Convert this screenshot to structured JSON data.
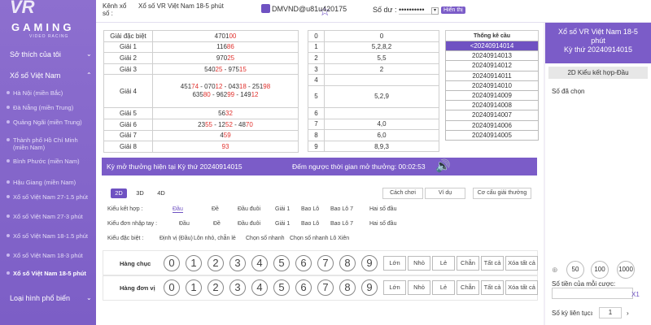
{
  "logo": {
    "main": "GAMING",
    "sub": "VIDEO RACING",
    "mark": "VR"
  },
  "sidebar": {
    "sections": [
      {
        "label": "Sở thích của tôi"
      },
      {
        "label": "Xổ số Việt Nam"
      },
      {
        "label": "Loại hình phổ biến"
      }
    ],
    "items": [
      {
        "label": "Hà Nội (miền Bắc)"
      },
      {
        "label": "Đà Nẵng (miền Trung)"
      },
      {
        "label": "Quảng Ngãi (miền Trung)"
      },
      {
        "label": "Thành phố Hồ Chí Minh (miền Nam)"
      },
      {
        "label": "Bình Phước (miền Nam)"
      },
      {
        "label": "Hậu Giang (miền Nam)"
      },
      {
        "label": "Xổ số Việt Nam 27-1.5 phút"
      },
      {
        "label": "Xổ số Việt Nam 27-3 phút"
      },
      {
        "label": "Xổ số Việt Nam 18-1.5 phút"
      },
      {
        "label": "Xổ số Việt Nam 18-3 phút"
      },
      {
        "label": "Xổ số Việt Nam 18-5 phút"
      }
    ]
  },
  "topbar": {
    "channel_label": "Kênh xổ số :",
    "channel_value": "Xổ số VR Việt Nam 18-5 phút",
    "username": "DMVND@u81u420175",
    "balance_label": "Số dư :",
    "balance_value": "••••••••••",
    "show_label": "Hiển thị"
  },
  "results": [
    {
      "prize": "Giải đặc biệt",
      "parts": [
        [
          "4701",
          "00"
        ]
      ]
    },
    {
      "prize": "Giải 1",
      "parts": [
        [
          "116",
          "86"
        ]
      ]
    },
    {
      "prize": "Giải 2",
      "parts": [
        [
          "970",
          "25"
        ]
      ]
    },
    {
      "prize": "Giải 3",
      "parts": [
        [
          "540",
          "25"
        ],
        [
          " - ",
          ""
        ],
        [
          "975",
          "15"
        ]
      ]
    },
    {
      "prize": "Giải 4",
      "parts": [
        [
          "451",
          "74"
        ],
        [
          " - ",
          ""
        ],
        [
          "070",
          "12"
        ],
        [
          " - ",
          ""
        ],
        [
          "043",
          "18"
        ],
        [
          " - ",
          ""
        ],
        [
          "251",
          "98"
        ],
        [
          "\n",
          ""
        ],
        [
          "635",
          "80"
        ],
        [
          " - ",
          ""
        ],
        [
          "962",
          "99"
        ],
        [
          " - ",
          ""
        ],
        [
          "149",
          "12"
        ]
      ]
    },
    {
      "prize": "Giải 5",
      "parts": [
        [
          "56",
          "32"
        ]
      ]
    },
    {
      "prize": "Giải 6",
      "parts": [
        [
          "23",
          "55"
        ],
        [
          " - ",
          ""
        ],
        [
          "12",
          "52"
        ],
        [
          " - ",
          ""
        ],
        [
          "48",
          "70"
        ]
      ]
    },
    {
      "prize": "Giải 7",
      "parts": [
        [
          "4",
          "59"
        ]
      ]
    },
    {
      "prize": "Giải 8",
      "parts": [
        [
          "",
          "93"
        ]
      ]
    }
  ],
  "head_tail": [
    {
      "head": "0",
      "tail": "0"
    },
    {
      "head": "1",
      "tail": "5,2,8,2"
    },
    {
      "head": "2",
      "tail": "5,5"
    },
    {
      "head": "3",
      "tail": "2"
    },
    {
      "head": "4",
      "tail": ""
    },
    {
      "head": "5",
      "tail": "5,2,9"
    },
    {
      "head": "6",
      "tail": ""
    },
    {
      "head": "7",
      "tail": "4,0"
    },
    {
      "head": "8",
      "tail": "6,0"
    },
    {
      "head": "9",
      "tail": "8,9,3"
    }
  ],
  "stats": {
    "title": "Thống kê cầu",
    "periods": [
      "<20240914014",
      "20240914013",
      "20240914012",
      "20240914011",
      "20240914010",
      "20240914009",
      "20240914008",
      "20240914007",
      "20240914006",
      "20240914005"
    ]
  },
  "countdown": {
    "period_text": "Kỳ mở thưởng hiện tại Kỳ thứ 20240914015",
    "timer_text": "Đếm ngược thời gian mở thưởng: 00:02:53"
  },
  "play": {
    "tabs": [
      "2D",
      "3D",
      "4D"
    ],
    "help_buttons": [
      "Cách chơi",
      "Ví dụ",
      "Cơ cấu giải thưởng"
    ],
    "rows": [
      {
        "label": "Kiểu kết hợp :",
        "options": [
          "Đầu",
          "Đề",
          "Đầu đuôi",
          "Giải 1",
          "Bao Lô",
          "Bao Lô 7",
          "Hai số đầu"
        ]
      },
      {
        "label": "Kiểu đơn nhập tay :",
        "options": [
          "Đầu",
          "Đề",
          "Đầu đuôi",
          "Giải 1",
          "Bao Lô",
          "Bao Lô 7",
          "Hai số đầu"
        ]
      },
      {
        "label": "Kiểu đặc biệt :",
        "options": [
          "Định vị (Đầu)",
          "Lôn nhỏ, chẵn lẻ",
          "Chọn số nhanh",
          "Chọn số nhanh Lô Xiên"
        ]
      }
    ],
    "digit_rows": [
      "Hàng chục",
      "Hàng đơn vị"
    ],
    "digits": [
      "0",
      "1",
      "2",
      "3",
      "4",
      "5",
      "6",
      "7",
      "8",
      "9"
    ],
    "quick": [
      "Lớn",
      "Nhỏ",
      "Lẻ",
      "Chẵn",
      "Tất cả",
      "Xóa tất cả"
    ]
  },
  "right_panel": {
    "title_line1": "Xổ số VR Việt Nam 18-5",
    "title_line2": "phút",
    "title_line3": "Kỳ thứ 20240914015",
    "mode": "2D Kiểu kết hợp-Đầu",
    "selected_label": "Số đã chọn",
    "chips": [
      "50",
      "100",
      "1000"
    ],
    "amount_label": "Số tiền của mỗi cược:",
    "multiplier": "X1",
    "periods_label": "Số kỳ liên tục:",
    "periods_value": "1"
  },
  "colors": {
    "accent": "#7b5cc8",
    "red": "#e0322e"
  }
}
